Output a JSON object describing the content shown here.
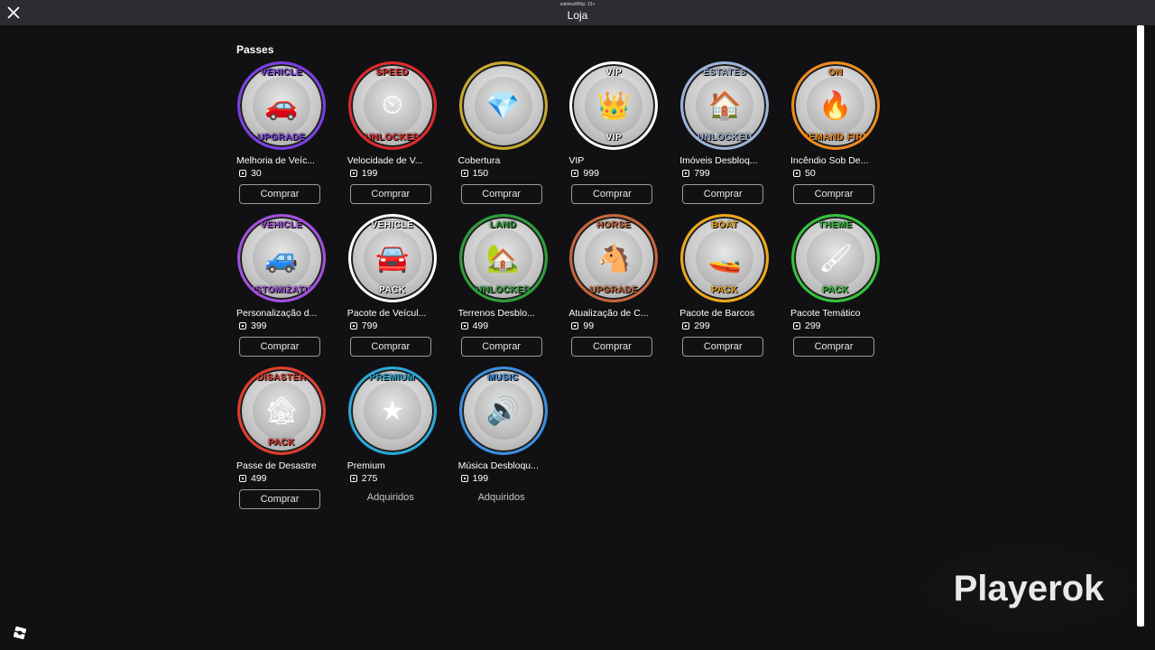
{
  "header": {
    "user": "sabrina960p: 13+",
    "title": "Loja"
  },
  "section": {
    "title": "Passes"
  },
  "items": [
    {
      "name": "Melhoria de Veíc...",
      "price": "30",
      "action": "Comprar",
      "badge_top": "VEHICLE",
      "badge_bot": "UPGRADE",
      "color": "#7b3fe4",
      "glyph": "🚗"
    },
    {
      "name": "Velocidade de V...",
      "price": "199",
      "action": "Comprar",
      "badge_top": "SPEED",
      "badge_bot": "UNLOCKED",
      "color": "#e0282c",
      "glyph": "⏲"
    },
    {
      "name": "Cobertura",
      "price": "150",
      "action": "Comprar",
      "badge_top": "",
      "badge_bot": "",
      "color": "#c9a82c",
      "glyph": "💎"
    },
    {
      "name": "VIP",
      "price": "999",
      "action": "Comprar",
      "badge_top": "VIP",
      "badge_bot": "VIP",
      "color": "#ffffff",
      "glyph": "👑"
    },
    {
      "name": "Imóveis Desbloq...",
      "price": "799",
      "action": "Comprar",
      "badge_top": "ESTATES",
      "badge_bot": "UNLOCKED",
      "color": "#9db4d8",
      "glyph": "🏠"
    },
    {
      "name": "Incêndio Sob De...",
      "price": "50",
      "action": "Comprar",
      "badge_top": "ON",
      "badge_bot": "DEMAND FIRE",
      "color": "#f08a1c",
      "glyph": "🔥"
    },
    {
      "name": "Personalização d...",
      "price": "399",
      "action": "Comprar",
      "badge_top": "VEHICLE",
      "badge_bot": "CUSTOMIZATION",
      "color": "#a24fe0",
      "glyph": "🚙"
    },
    {
      "name": "Pacote de Veícul...",
      "price": "799",
      "action": "Comprar",
      "badge_top": "VEHICLE",
      "badge_bot": "PACK",
      "color": "#ffffff",
      "glyph": "🚘"
    },
    {
      "name": "Terrenos Desblo...",
      "price": "499",
      "action": "Comprar",
      "badge_top": "LAND",
      "badge_bot": "UNLOCKED",
      "color": "#2e9e3a",
      "glyph": "🏡"
    },
    {
      "name": "Atualização de C...",
      "price": "99",
      "action": "Comprar",
      "badge_top": "HORSE",
      "badge_bot": "UPGRADE",
      "color": "#c8643c",
      "glyph": "🐴"
    },
    {
      "name": "Pacote de Barcos",
      "price": "299",
      "action": "Comprar",
      "badge_top": "BOAT",
      "badge_bot": "PACK",
      "color": "#f0a81c",
      "glyph": "🚤"
    },
    {
      "name": "Pacote Temático",
      "price": "299",
      "action": "Comprar",
      "badge_top": "THEME",
      "badge_bot": "PACK",
      "color": "#34c23c",
      "glyph": "🖌"
    },
    {
      "name": "Passe de Desastre",
      "price": "499",
      "action": "Comprar",
      "badge_top": "DISASTER",
      "badge_bot": "PACK",
      "color": "#e03c2c",
      "glyph": "🏚"
    },
    {
      "name": "Premium",
      "price": "275",
      "action": "Adquiridos",
      "badge_top": "PREMIUM",
      "badge_bot": "",
      "color": "#2aa8d8",
      "glyph": "★"
    },
    {
      "name": "Música Desbloqu...",
      "price": "199",
      "action": "Adquiridos",
      "badge_top": "MUSIC",
      "badge_bot": "",
      "color": "#3c8ee0",
      "glyph": "🔊"
    }
  ],
  "watermark": "Playerok",
  "icons": {
    "close": "close-icon",
    "currency": "robux-icon",
    "logo": "roblox-logo-icon"
  }
}
